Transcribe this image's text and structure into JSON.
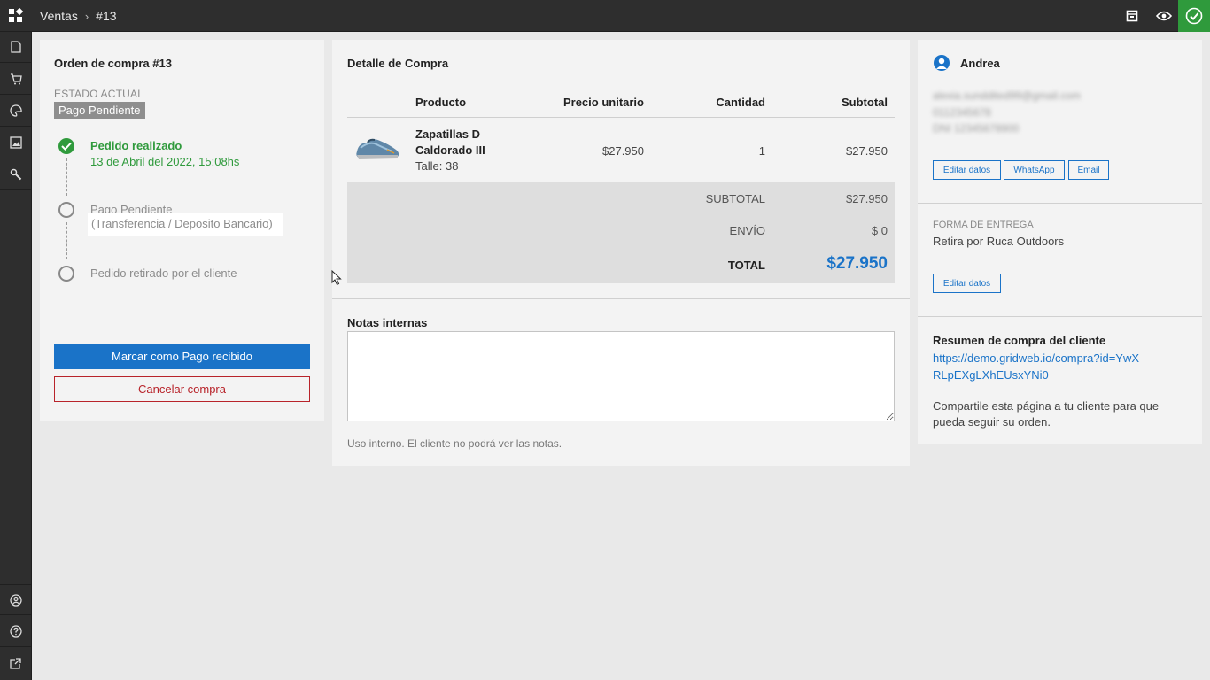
{
  "topbar": {
    "breadcrumb": [
      "Ventas",
      "#13"
    ],
    "breadcrumb_sep": "›",
    "icons": [
      "dashboard-icon",
      "archive-icon",
      "preview-eye-icon",
      "check-icon"
    ]
  },
  "sidebar": {
    "items": [
      "document-icon",
      "cart-icon",
      "palette-icon",
      "image-icon",
      "tools-icon"
    ],
    "bottom": [
      "user-icon",
      "help-icon",
      "external-link-icon"
    ]
  },
  "order": {
    "title": "Orden de compra #13",
    "estado_label": "ESTADO ACTUAL",
    "estado_value": "Pago Pendiente",
    "steps": [
      {
        "title": "Pedido realizado",
        "date": "13 de Abril del 2022, 15:08hs"
      },
      {
        "title": "Pago Pendiente",
        "detail": "(Transferencia / Deposito Bancario)"
      },
      {
        "title": "Pedido retirado por el cliente"
      }
    ],
    "primary_button": "Marcar como Pago recibido",
    "cancel_button": "Cancelar compra"
  },
  "detail": {
    "title": "Detalle de Compra",
    "columns": [
      "Producto",
      "Precio unitario",
      "Cantidad",
      "Subtotal"
    ],
    "items": [
      {
        "name": "Zapatillas D Caldorado III",
        "size": "Talle: 38",
        "unit_price": "$27.950",
        "qty": "1",
        "subtotal": "$27.950"
      }
    ],
    "subtotal_label": "SUBTOTAL",
    "subtotal_value": "$27.950",
    "envio_label": "ENVÍO",
    "envio_value": "$ 0",
    "total_label": "TOTAL",
    "total_value": "$27.950"
  },
  "notes": {
    "title": "Notas internas",
    "help": "Uso interno. El cliente no podrá ver las notas."
  },
  "customer": {
    "name": "Andrea",
    "email": "alexia.sunddited99@gmail.com",
    "phone": "0112345678",
    "dni": "DNI 12345678900",
    "buttons": [
      "Editar datos",
      "WhatsApp",
      "Email"
    ],
    "forma_label": "FORMA DE ENTREGA",
    "forma_value": "Retira por Ruca Outdoors",
    "forma_button": "Editar datos",
    "resumen_title": "Resumen de compra del cliente",
    "resumen_link": "https://demo.gridweb.io/compra?id=YwXRLpEXgLXhEUsxYNi0",
    "resumen_text": "Compartile esta página a tu cliente para que pueda seguir su orden."
  },
  "colors": {
    "accent": "#1a73c8",
    "success": "#2f9a3c",
    "danger": "#b8232a",
    "chrome": "#2e2e2e"
  }
}
